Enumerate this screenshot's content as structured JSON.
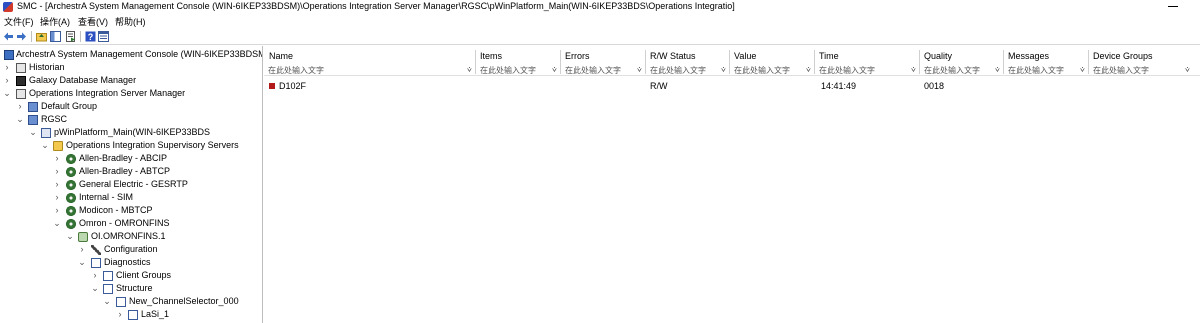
{
  "window": {
    "title": "SMC - [ArchestrA System Management Console (WIN-6IKEP33BDSM)\\Operations Integration Server Manager\\RGSC\\pWinPlatform_Main(WIN-6IKEP33BDS\\Operations Integratio]"
  },
  "menu": {
    "file": "文件(F)",
    "action": "操作(A)",
    "view": "查看(V)",
    "help": "帮助(H)"
  },
  "tree": {
    "root": "ArchestrA System Management Console (WIN-6IKEP33BDSM)",
    "historian": "Historian",
    "galaxy_db": "Galaxy Database Manager",
    "ois_manager": "Operations Integration Server Manager",
    "default_group": "Default Group",
    "rgsc": "RGSC",
    "platform": "pWinPlatform_Main(WIN-6IKEP33BDS",
    "supervisory": "Operations Integration Supervisory Servers",
    "abcip": "Allen-Bradley - ABCIP",
    "abtcp": "Allen-Bradley - ABTCP",
    "gesrtp": "General Electric - GESRTP",
    "sim": "Internal - SIM",
    "mbtcp": "Modicon - MBTCP",
    "omronfins": "Omron - OMRONFINS",
    "oi_omronfins": "OI.OMRONFINS.1",
    "configuration": "Configuration",
    "diagnostics": "Diagnostics",
    "client_groups": "Client Groups",
    "structure": "Structure",
    "channel_selector": "New_ChannelSelector_000",
    "lasi": "LaSi_1"
  },
  "table": {
    "filter_placeholder": "在此处输入文字",
    "columns": [
      "Name",
      "Items",
      "Errors",
      "R/W Status",
      "Value",
      "Time",
      "Quality",
      "Messages",
      "Device Groups"
    ],
    "rows": [
      {
        "name": "D102F",
        "items": "",
        "errors": "",
        "rw_status": "R/W",
        "value": "",
        "time": "14:41:49",
        "quality": "0018",
        "messages": "",
        "device_groups": ""
      }
    ]
  }
}
